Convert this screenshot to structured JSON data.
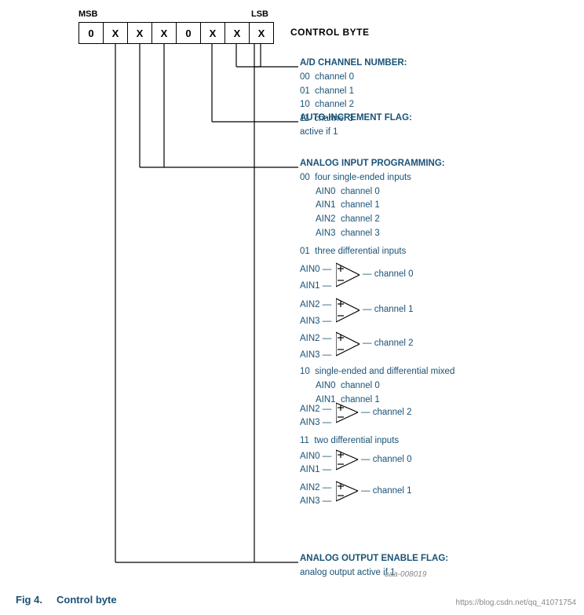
{
  "labels": {
    "msb": "MSB",
    "lsb": "LSB",
    "control_byte": "CONTROL BYTE",
    "fig_num": "Fig 4.",
    "fig_title": "Control byte",
    "url": "https://blog.csdn.net/qq_41071754",
    "ref": "aaa-008019"
  },
  "bits": [
    "0",
    "X",
    "X",
    "X",
    "0",
    "X",
    "X",
    "X"
  ],
  "annotations": {
    "ad_channel": {
      "title": "A/D CHANNEL NUMBER:",
      "lines": [
        "00  channel 0",
        "01  channel 1",
        "10  channel 2",
        "11  channel 3"
      ]
    },
    "auto_inc": {
      "title": "AUTO-INCREMENT FLAG:",
      "lines": [
        "active if 1"
      ]
    },
    "analog_input": {
      "title": "ANALOG INPUT PROGRAMMING:",
      "lines_00": [
        "00  four single-ended inputs",
        "    AIN0  channel 0",
        "    AIN1  channel 1",
        "    AIN2  channel 2",
        "    AIN3  channel 3"
      ],
      "lines_01": [
        "01  three differential inputs"
      ],
      "lines_10": [
        "10  single-ended and differential mixed",
        "    AIN0  channel 0",
        "    AIN1  channel 1"
      ],
      "lines_11": [
        "11  two differential inputs"
      ]
    },
    "analog_output": {
      "title": "ANALOG OUTPUT ENABLE FLAG:",
      "lines": [
        "analog output active if 1"
      ]
    }
  },
  "diff_labels": {
    "ch0": "channel 0",
    "ch1": "channel 1",
    "ch2": "channel 2",
    "ch3": "channel 3"
  }
}
